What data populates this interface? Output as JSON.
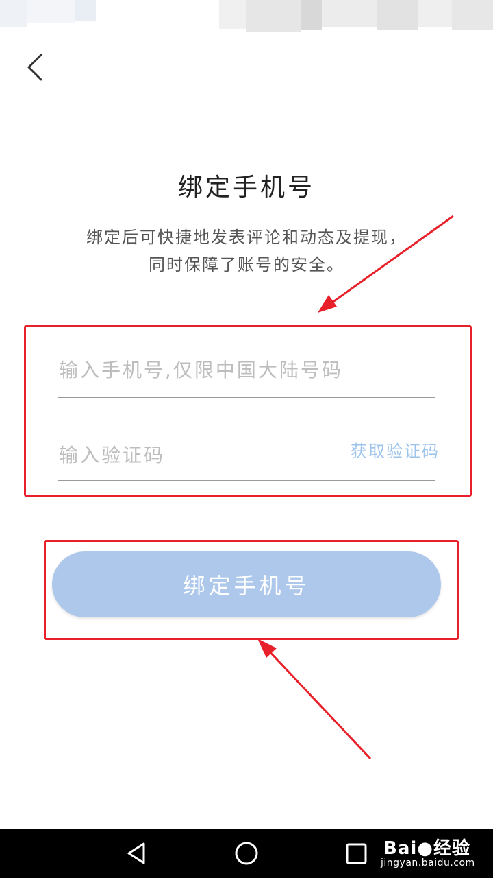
{
  "page": {
    "title": "绑定手机号",
    "subtitle_line1": "绑定后可快捷地发表评论和动态及提现，",
    "subtitle_line2": "同时保障了账号的安全。"
  },
  "form": {
    "phone_placeholder": "输入手机号,仅限中国大陆号码",
    "phone_value": "",
    "code_placeholder": "输入验证码",
    "code_value": "",
    "get_code_label": "获取验证码"
  },
  "actions": {
    "bind_button_label": "绑定手机号"
  },
  "watermark": {
    "brand": "Bai●经验",
    "url": "jingyan.baidu.com"
  },
  "icons": {
    "back": "chevron-left-icon",
    "nav_back": "triangle-back-icon",
    "nav_home": "circle-home-icon",
    "nav_recent": "square-recent-icon"
  },
  "colors": {
    "accent_light": "#aec8ec",
    "link": "#9ec4ec",
    "annotation": "#e8202a",
    "nav_background": "#000000"
  }
}
